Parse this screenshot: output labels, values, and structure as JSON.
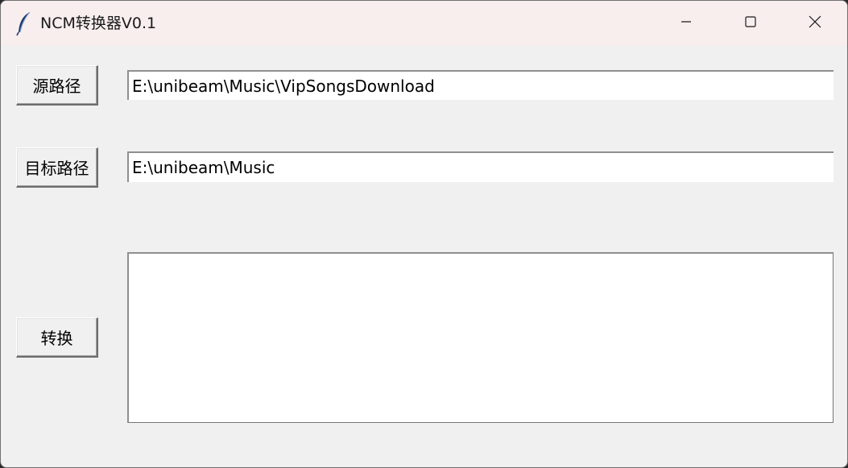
{
  "window": {
    "title": "NCM转换器V0.1",
    "icon": "feather-icon",
    "caption_buttons": [
      "minimize-icon",
      "maximize-icon",
      "close-icon"
    ]
  },
  "source": {
    "button_label": "源路径",
    "path_value": "E:\\unibeam\\Music\\VipSongsDownload"
  },
  "target": {
    "button_label": "目标路径",
    "path_value": "E:\\unibeam\\Music"
  },
  "convert": {
    "button_label": "转换",
    "log_text": ""
  },
  "colors": {
    "titlebar": "#f8eeee",
    "background": "#f0f0f0",
    "field": "#ffffff"
  }
}
